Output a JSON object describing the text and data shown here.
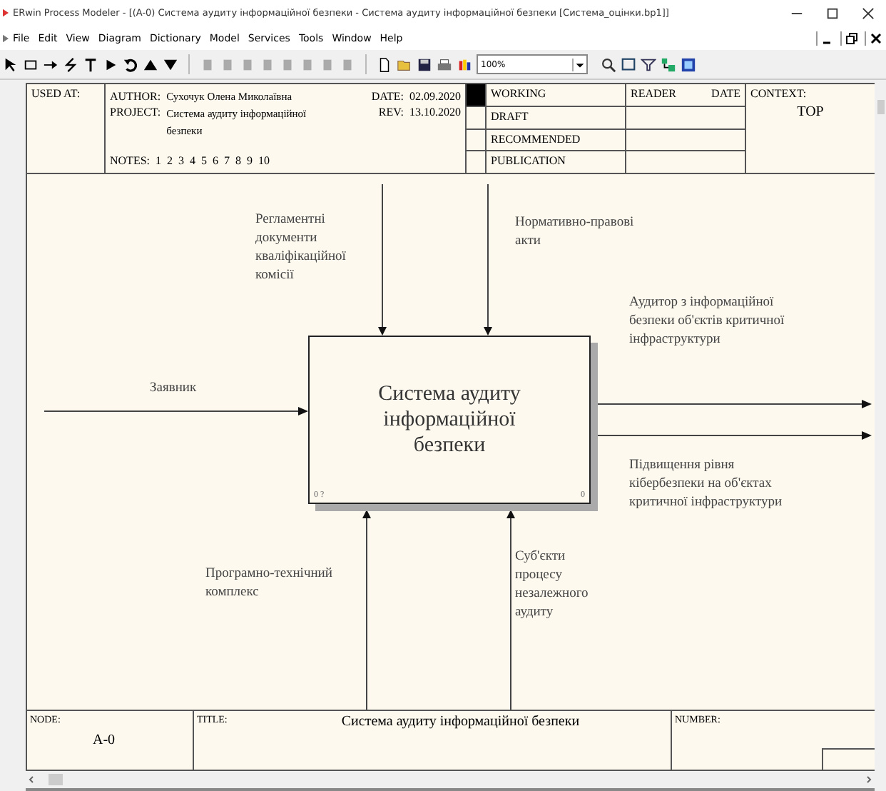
{
  "window": {
    "title": "ERwin Process Modeler - [(A-0) Система аудиту інформаційної безпеки - Система аудиту інформаційної безпеки  [Система_оцінки.bp1]]"
  },
  "menu": [
    "File",
    "Edit",
    "View",
    "Diagram",
    "Dictionary",
    "Model",
    "Services",
    "Tools",
    "Window",
    "Help"
  ],
  "toolbar": {
    "zoom": "100%"
  },
  "header": {
    "used_at": "USED AT:",
    "author_label": "AUTHOR:",
    "author": "Сухочук Олена Миколаївна",
    "date_label": "DATE:",
    "date": "02.09.2020",
    "project_label": "PROJECT:",
    "project": "Система аудиту інформаційної безпеки",
    "rev_label": "REV:",
    "rev": "13.10.2020",
    "notes_label": "NOTES:",
    "notes": [
      "1",
      "2",
      "3",
      "4",
      "5",
      "6",
      "7",
      "8",
      "9",
      "10"
    ],
    "statuses": [
      {
        "label": "WORKING",
        "selected": true
      },
      {
        "label": "DRAFT",
        "selected": false
      },
      {
        "label": "RECOMMENDED",
        "selected": false
      },
      {
        "label": "PUBLICATION",
        "selected": false
      }
    ],
    "reader": "READER",
    "reader_date": "DATE",
    "context": "CONTEXT:",
    "context_value": "TOP"
  },
  "diagram": {
    "box": {
      "title": "Система аудиту інформаційної безпеки",
      "cost": "0 ?",
      "number": "0"
    },
    "arrows": [
      {
        "kind": "control",
        "label": "Регламентні документи кваліфікаційної комісії"
      },
      {
        "kind": "control",
        "label": "Нормативно-правові акти"
      },
      {
        "kind": "input",
        "label": "Заявник"
      },
      {
        "kind": "output",
        "label": "Аудитор з інформаційної безпеки об'єктів критичної інфраструктури"
      },
      {
        "kind": "output",
        "label": "Підвищення рівня кібербезпеки на об'єктах критичної інфраструктури"
      },
      {
        "kind": "mechanism",
        "label": "Програмно-технічний комплекс"
      },
      {
        "kind": "mechanism",
        "label": "Суб'єкти процесу незалежного аудиту"
      }
    ]
  },
  "footer": {
    "node_label": "NODE:",
    "node": "A-0",
    "title_label": "TITLE:",
    "title": "Система аудиту  інформаційної  безпеки",
    "number_label": "NUMBER:"
  }
}
